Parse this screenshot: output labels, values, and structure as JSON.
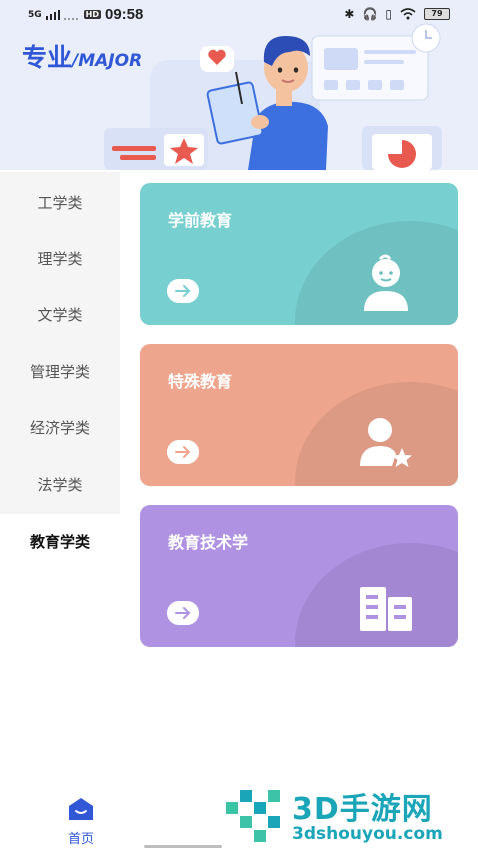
{
  "status_bar": {
    "signal_label": "5G",
    "hd_label": "HD",
    "time": "09:58",
    "battery": "79"
  },
  "header": {
    "brand_cn": "专业",
    "brand_en": "/MAJOR"
  },
  "sidebar": {
    "items": [
      {
        "label": "工学类"
      },
      {
        "label": "理学类"
      },
      {
        "label": "文学类"
      },
      {
        "label": "管理学类"
      },
      {
        "label": "经济学类"
      },
      {
        "label": "法学类"
      },
      {
        "label": "教育学类",
        "active": true
      }
    ]
  },
  "cards": [
    {
      "title": "学前教育",
      "color": "#78cfd0",
      "icon": "baby-icon"
    },
    {
      "title": "特殊教育",
      "color": "#eda58d",
      "icon": "person-star-icon"
    },
    {
      "title": "教育技术学",
      "color": "#b092e2",
      "icon": "building-icon"
    }
  ],
  "bottom_nav": {
    "home_label": "首页"
  },
  "watermark": {
    "title": "3D手游网",
    "subtitle": "3dshouyou.com"
  },
  "colors": {
    "brand": "#2f57d6",
    "banner_bg": "#e9eefa",
    "sidebar_bg": "#f5f5f5"
  }
}
